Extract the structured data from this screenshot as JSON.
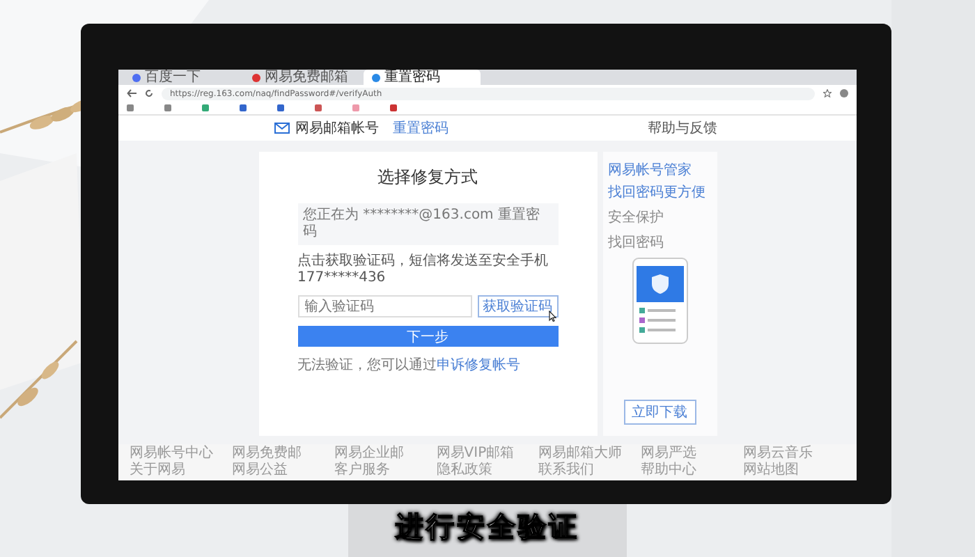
{
  "browser": {
    "tabs": [
      {
        "title": "百度一下",
        "selected": false
      },
      {
        "title": "网易免费邮箱",
        "selected": false
      },
      {
        "title": "重置密码",
        "selected": true
      }
    ],
    "address": "https://reg.163.com/naq/findPassword#/verifyAuth"
  },
  "header": {
    "logo": "网易邮箱帐号",
    "subtitle": "重置密码",
    "help": "帮助与反馈"
  },
  "card": {
    "title": "选择修复方式",
    "notice": "您正在为 ********@163.com 重置密码",
    "instruction": "点击获取验证码，短信将发送至安全手机177*****436",
    "code_field": {
      "placeholder": "输入验证码"
    },
    "send_button": "获取验证码",
    "next_button": "下一步",
    "note_text": "无法验证，您可以通过",
    "note_link": "申诉修复帐号"
  },
  "promo": {
    "title_lines": [
      "网易帐号管家",
      "找回密码更方便"
    ],
    "bullets": [
      "安全保护",
      "找回密码"
    ],
    "button": "立即下载"
  },
  "footer": {
    "rows": [
      [
        "网易帐号中心",
        "网易免费邮",
        "网易企业邮",
        "网易VIP邮箱",
        "网易邮箱大师",
        "网易严选",
        "网易云音乐"
      ],
      [
        "关于网易",
        "网易公益",
        "客户服务",
        "隐私政策",
        "联系我们",
        "帮助中心",
        "网站地图"
      ]
    ]
  },
  "caption": "进行安全验证"
}
